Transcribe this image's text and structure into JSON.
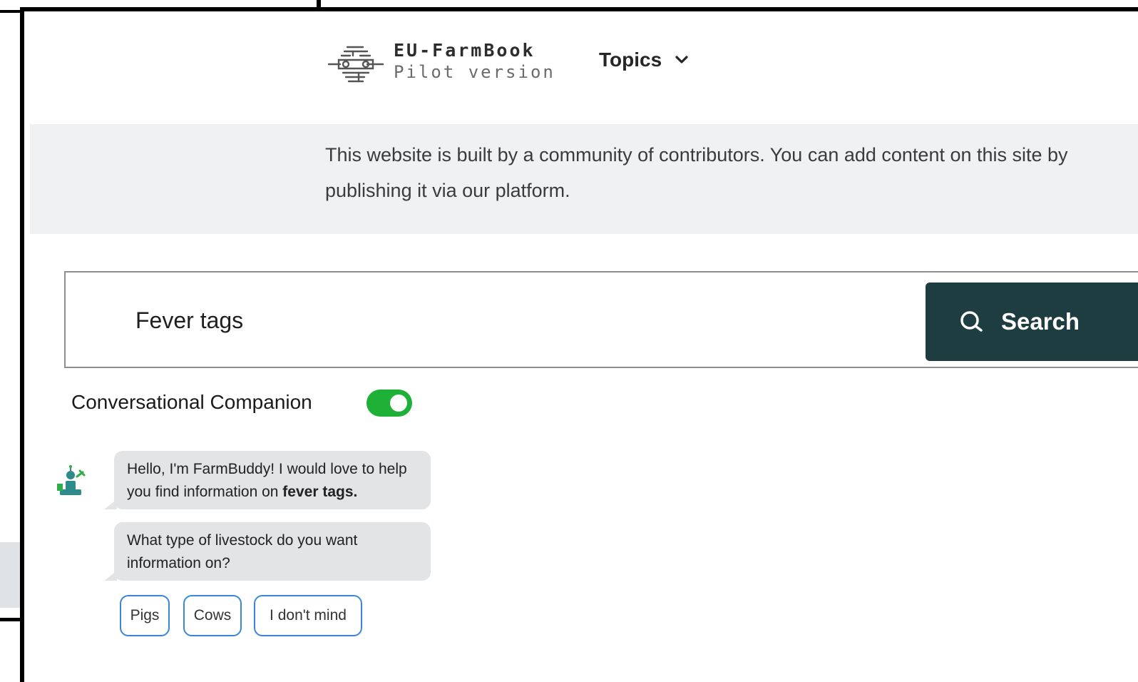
{
  "header": {
    "brand_name": "EU-FarmBook",
    "brand_subtitle": "Pilot version",
    "logo_icon": "tractor-network-icon",
    "topics_label": "Topics",
    "topics_icon": "chevron-down-icon"
  },
  "banner": {
    "text": "This website is built by a community of contributors. You can add content on this site by publishing it via our platform."
  },
  "search": {
    "value": "Fever tags",
    "button_label": "Search",
    "button_icon": "search-icon"
  },
  "companion": {
    "label": "Conversational Companion",
    "toggle_on": true
  },
  "chat": {
    "bot_icon": "farmbuddy-avatar-icon",
    "message1_prefix": "Hello, I'm FarmBuddy! I would love to help you find information on ",
    "message1_bold": "fever tags.",
    "message2": "What type of livestock do you want information on?",
    "options": [
      "Pigs",
      "Cows",
      "I don't mind"
    ]
  },
  "colors": {
    "search_button_bg": "#1e3d40",
    "toggle_on": "#1fb037",
    "chip_border": "#3a86d6",
    "banner_bg": "#f0f1f3",
    "bubble_bg": "#e3e4e5"
  }
}
